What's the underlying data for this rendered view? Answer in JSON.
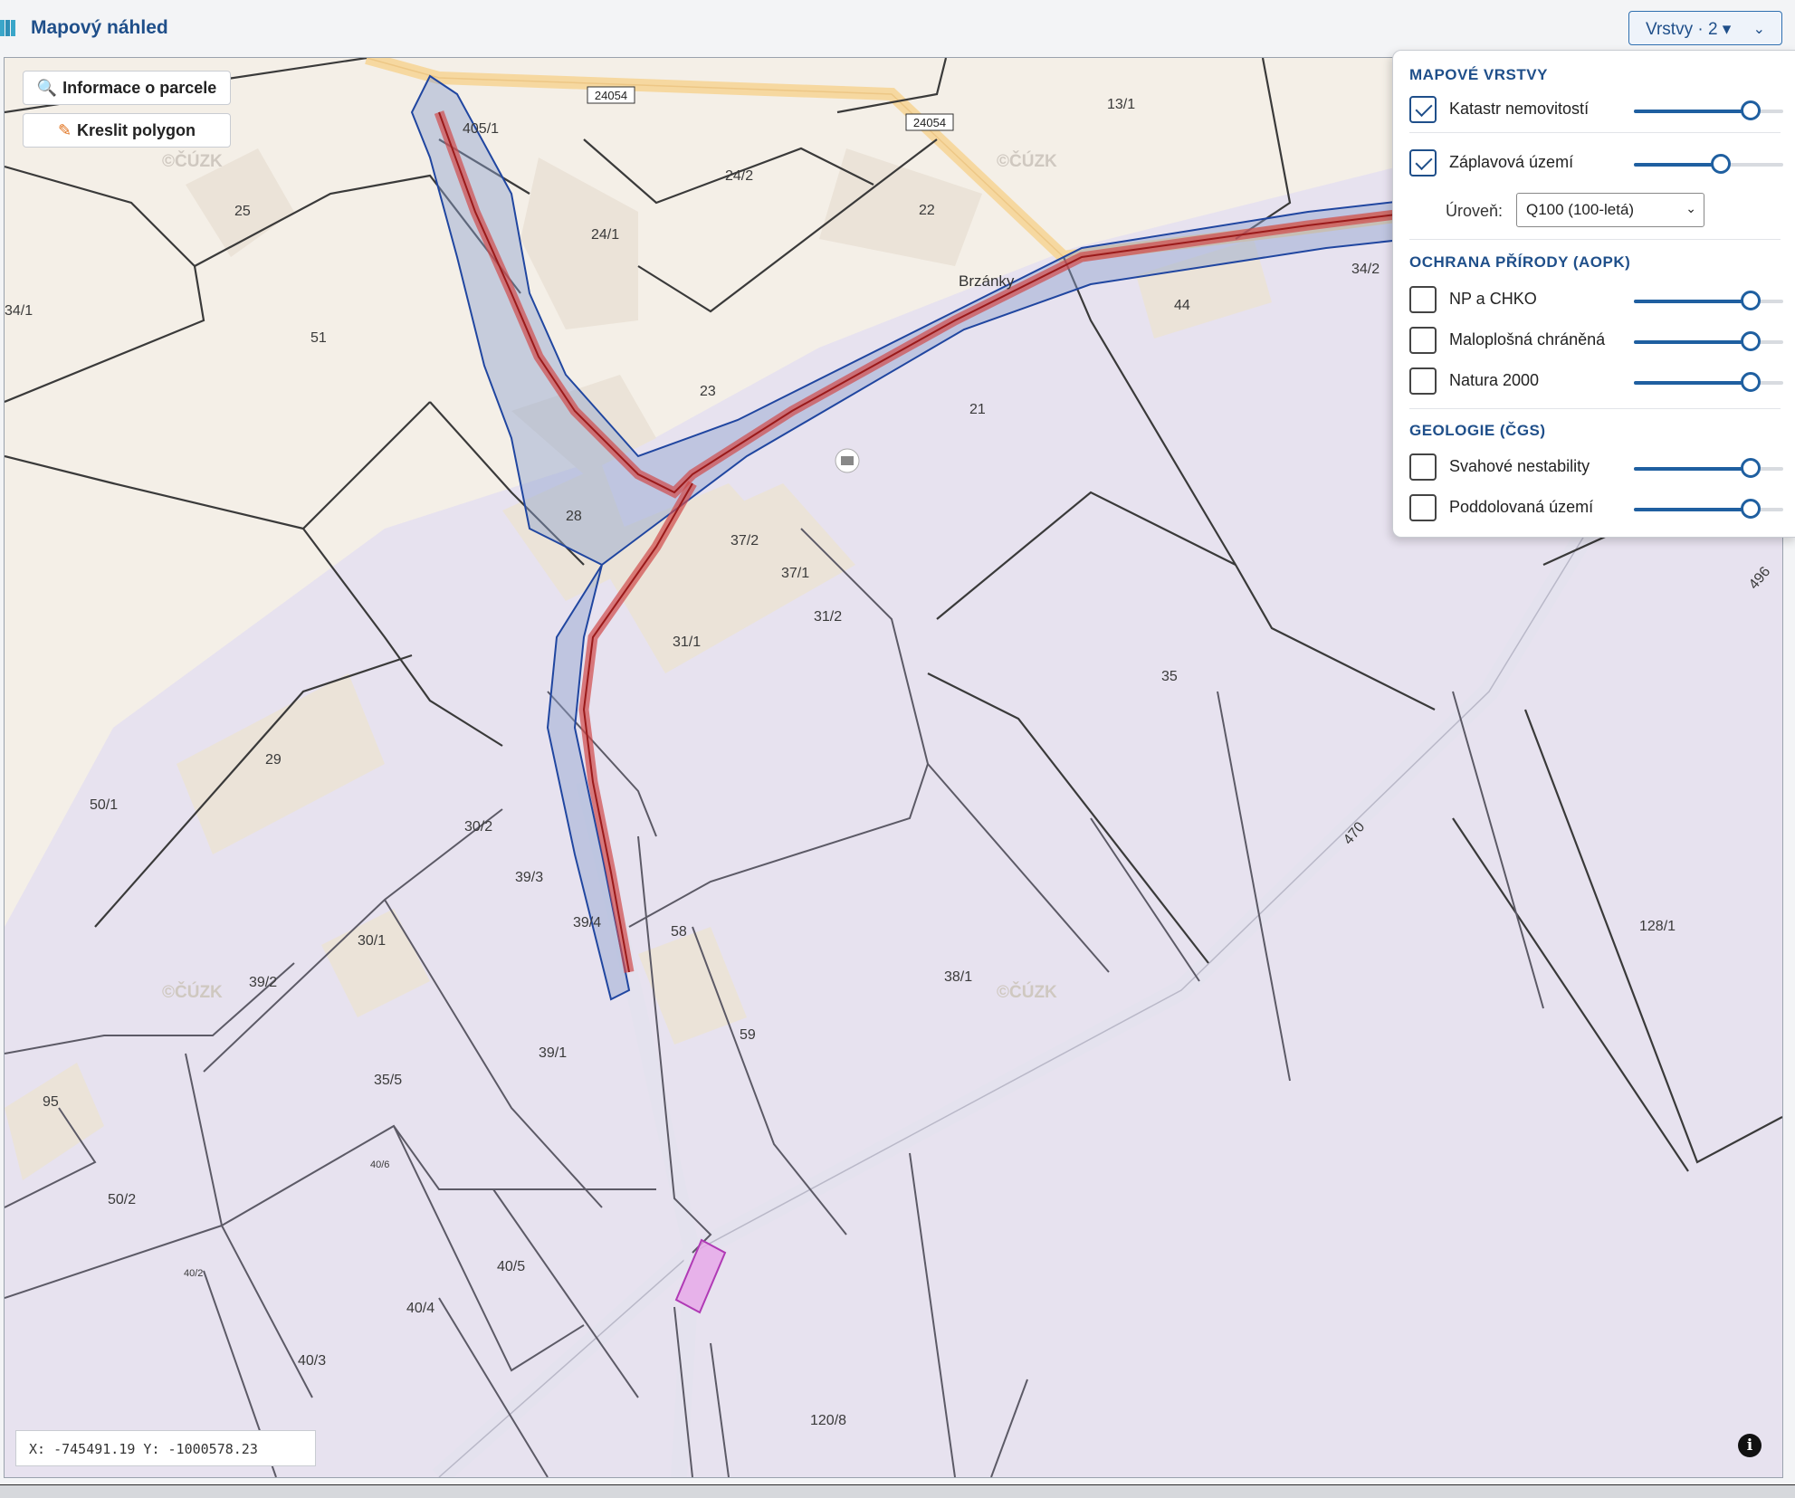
{
  "header": {
    "title": "Mapový náhled",
    "layers_button": "Vrstvy · 2 ▾"
  },
  "toolbar": {
    "parcel_info": "Informace o parcele",
    "draw_polygon": "Kreslit polygon"
  },
  "coords": "X: -745491.19 Y: -1000578.23",
  "info_button": "i",
  "panel": {
    "sections": [
      {
        "title": "MAPOVÉ VRSTVY"
      },
      {
        "title": "OCHRANA PŘÍRODY (AOPK)"
      },
      {
        "title": "GEOLOGIE (ČGS)"
      }
    ],
    "layers": [
      {
        "label": "Katastr nemovitostí",
        "checked": true,
        "opacity": 0.78
      },
      {
        "label": "Záplavová území",
        "checked": true,
        "opacity": 0.58
      },
      {
        "label": "NP a CHKO",
        "checked": false,
        "opacity": 0.78
      },
      {
        "label": "Maloplošná chráněná",
        "checked": false,
        "opacity": 0.78
      },
      {
        "label": "Natura 2000",
        "checked": false,
        "opacity": 0.78
      },
      {
        "label": "Svahové nestability",
        "checked": false,
        "opacity": 0.78
      },
      {
        "label": "Poddolovaná území",
        "checked": false,
        "opacity": 0.78
      }
    ],
    "level_label": "Úroveň:",
    "level_value": "Q100 (100-letá)"
  },
  "map": {
    "place_label": "Brzánky",
    "road_labels": [
      "24054",
      "24054"
    ],
    "parcel_labels": [
      "405/1",
      "13/1",
      "24/2",
      "22",
      "25",
      "24/1",
      "51",
      "34/1",
      "23",
      "21",
      "44",
      "34/2",
      "28",
      "37/2",
      "37/1",
      "31/1",
      "31/2",
      "35",
      "29",
      "50/1",
      "30/2",
      "39/3",
      "39/4",
      "30/1",
      "39/2",
      "58",
      "38/1",
      "128/1",
      "59",
      "35/5",
      "39/1",
      "95",
      "50/2",
      "40/5",
      "40/4",
      "40/3",
      "120/8",
      "470",
      "496",
      "40/2",
      "40/6"
    ],
    "watermarks": [
      "©ČÚZK",
      "©ČÚZK",
      "©ČÚZK",
      "©ČÚZK"
    ]
  }
}
